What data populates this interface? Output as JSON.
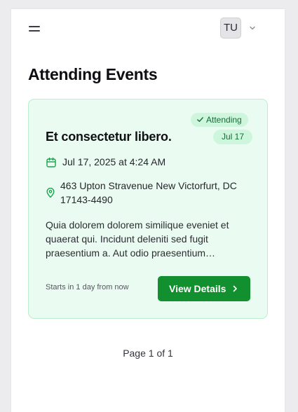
{
  "header": {
    "avatar_initials": "TU"
  },
  "page": {
    "title": "Attending Events"
  },
  "event": {
    "status": "Attending",
    "title": "Et consectetur libero.",
    "date_badge": "Jul 17",
    "datetime": "Jul 17, 2025 at 4:24 AM",
    "location": "463 Upton Stravenue New Victorfurt, DC 17143-4490",
    "description": "Quia dolorem dolorem similique eveniet et quaerat qui. Incidunt deleniti sed fugit praesentium a. Aut odio praesentium…",
    "starts_in": "Starts in 1 day from now",
    "action_label": "View Details"
  },
  "pagination": {
    "text": "Page 1 of 1"
  },
  "icons": {
    "menu": "menu-icon",
    "chevron": "chevron-down-icon",
    "check": "check-icon",
    "calendar": "calendar-icon",
    "location": "map-pin-icon",
    "arrow": "chevron-right-icon"
  },
  "colors": {
    "accent": "#12902f",
    "card_bg": "#eafcf1",
    "badge_bg": "#cdf6dd",
    "badge_text": "#166b38"
  }
}
